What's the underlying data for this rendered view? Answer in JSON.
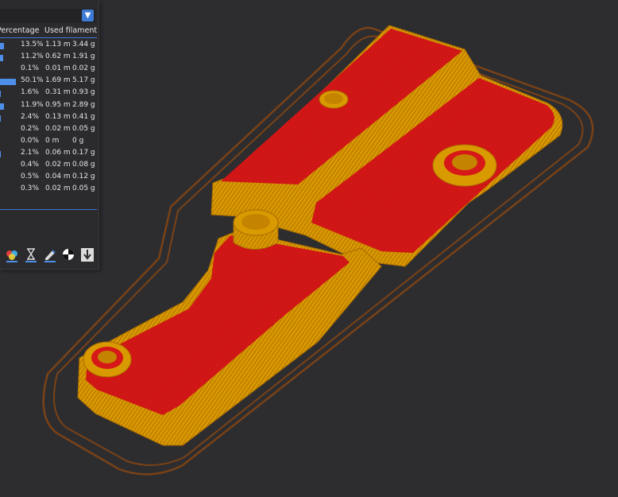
{
  "dropdown": {
    "icon": "chevron-down-icon",
    "arrow": "▼"
  },
  "headers": {
    "percentage": "Percentage",
    "used_filament": "Used filament"
  },
  "rows": [
    {
      "pct": "13.5%",
      "len": "1.13 m",
      "wt": "3.44 g",
      "bar": 0.135
    },
    {
      "pct": "11.2%",
      "len": "0.62 m",
      "wt": "1.91 g",
      "bar": 0.112
    },
    {
      "pct": "0.1%",
      "len": "0.01 m",
      "wt": "0.02 g",
      "bar": 0.001
    },
    {
      "pct": "50.1%",
      "len": "1.69 m",
      "wt": "5.17 g",
      "bar": 0.501
    },
    {
      "pct": "1.6%",
      "len": "0.31 m",
      "wt": "0.93 g",
      "bar": 0.016
    },
    {
      "pct": "11.9%",
      "len": "0.95 m",
      "wt": "2.89 g",
      "bar": 0.119
    },
    {
      "pct": "2.4%",
      "len": "0.13 m",
      "wt": "0.41 g",
      "bar": 0.024
    },
    {
      "pct": "0.2%",
      "len": "0.02 m",
      "wt": "0.05 g",
      "bar": 0.002
    },
    {
      "pct": "0.0%",
      "len": "0 m",
      "wt": "0 g",
      "bar": 0.0
    },
    {
      "pct": "2.1%",
      "len": "0.06 m",
      "wt": "0.17 g",
      "bar": 0.021
    },
    {
      "pct": "0.4%",
      "len": "0.02 m",
      "wt": "0.08 g",
      "bar": 0.004
    },
    {
      "pct": "0.5%",
      "len": "0.04 m",
      "wt": "0.12 g",
      "bar": 0.005
    },
    {
      "pct": "0.3%",
      "len": "0.02 m",
      "wt": "0.05 g",
      "bar": 0.003
    }
  ],
  "toolbar": [
    {
      "icon": "color-scheme-icon"
    },
    {
      "icon": "hourglass-icon"
    },
    {
      "icon": "edit-pencil-icon"
    },
    {
      "icon": "checker-ball-icon"
    },
    {
      "icon": "export-arrow-icon"
    }
  ],
  "colors": {
    "accent": "#3d7bd6",
    "infill": "#d61818",
    "wall": "#e0a000",
    "skirt": "#8b4a12",
    "background": "#2d2d30"
  }
}
